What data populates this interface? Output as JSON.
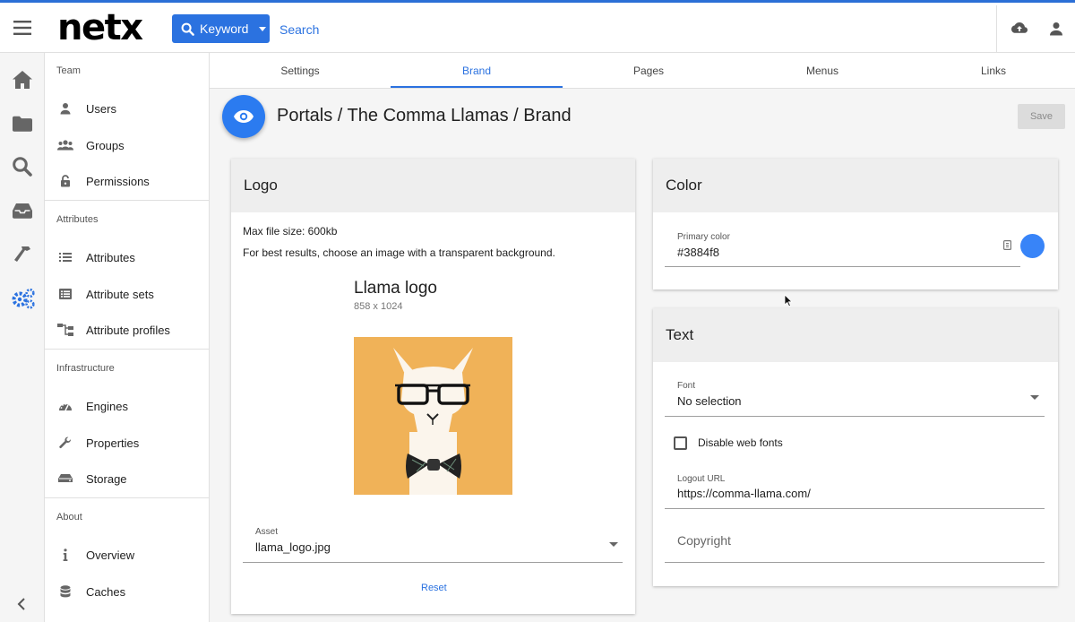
{
  "app": {
    "logo_text": "netx",
    "keyword_label": "Keyword",
    "search_placeholder": "Search"
  },
  "colors": {
    "accent": "#2b72e0",
    "brand_top_border": "#2b6fd6",
    "primary_swatch": "#3884f8"
  },
  "rail": {
    "icons": [
      "home-icon",
      "folder-icon",
      "search-icon",
      "inbox-icon",
      "hammer-icon",
      "settings-gears-icon"
    ]
  },
  "sidebar": {
    "sections": [
      {
        "title": "Team",
        "items": [
          {
            "label": "Users",
            "icon": "person-icon"
          },
          {
            "label": "Groups",
            "icon": "group-icon"
          },
          {
            "label": "Permissions",
            "icon": "lock-open-icon"
          }
        ]
      },
      {
        "title": "Attributes",
        "items": [
          {
            "label": "Attributes",
            "icon": "list-icon"
          },
          {
            "label": "Attribute sets",
            "icon": "table-list-icon"
          },
          {
            "label": "Attribute profiles",
            "icon": "hierarchy-icon"
          }
        ]
      },
      {
        "title": "Infrastructure",
        "items": [
          {
            "label": "Engines",
            "icon": "gauge-icon"
          },
          {
            "label": "Properties",
            "icon": "wrench-icon"
          },
          {
            "label": "Storage",
            "icon": "hard-drive-icon"
          }
        ]
      },
      {
        "title": "About",
        "items": [
          {
            "label": "Overview",
            "icon": "info-icon"
          },
          {
            "label": "Caches",
            "icon": "database-icon"
          }
        ]
      }
    ]
  },
  "tabs": [
    {
      "label": "Settings",
      "active": false
    },
    {
      "label": "Brand",
      "active": true
    },
    {
      "label": "Pages",
      "active": false
    },
    {
      "label": "Menus",
      "active": false
    },
    {
      "label": "Links",
      "active": false
    }
  ],
  "page": {
    "breadcrumb": "Portals / The Comma Llamas / Brand",
    "save_label": "Save"
  },
  "logo_card": {
    "title": "Logo",
    "max_size": "Max file size: 600kb",
    "hint": "For best results, choose an image with a transparent background.",
    "asset_title": "Llama logo",
    "asset_dims": "858 x 1024",
    "asset_label": "Asset",
    "asset_value": "llama_logo.jpg",
    "reset_label": "Reset"
  },
  "color_card": {
    "title": "Color",
    "primary_label": "Primary color",
    "primary_value": "#3884f8"
  },
  "text_card": {
    "title": "Text",
    "font_label": "Font",
    "font_value": "No selection",
    "disable_web_fonts_label": "Disable web fonts",
    "disable_web_fonts_checked": false,
    "logout_label": "Logout URL",
    "logout_value": "https://comma-llama.com/",
    "copyright_placeholder": "Copyright"
  }
}
